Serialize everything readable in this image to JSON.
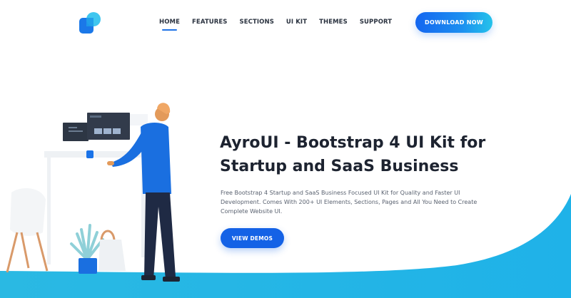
{
  "header": {
    "logo": "ayroui-logo",
    "nav": [
      {
        "label": "HOME",
        "active": true
      },
      {
        "label": "FEATURES",
        "active": false
      },
      {
        "label": "SECTIONS",
        "active": false
      },
      {
        "label": "UI KIT",
        "active": false
      },
      {
        "label": "THEMES",
        "active": false
      },
      {
        "label": "SUPPORT",
        "active": false
      }
    ],
    "cta_label": "DOWNLOAD NOW"
  },
  "hero": {
    "title_line1": "AyroUI - Bootstrap 4 UI Kit for",
    "title_line2": "Startup and SaaS Business",
    "desc_line1": "Free Bootstrap 4 Startup and SaaS Business Focused UI Kit for Quality and Faster UI",
    "desc_line2": "Development. Comes With 200+ UI Elements, Sections, Pages and All You Need to Create",
    "desc_line3": "Complete Website UI.",
    "button_label": "VIEW DEMOS"
  },
  "colors": {
    "accent": "#1462e6",
    "gradient_end": "#25c3ea",
    "wave": "#22b8e6",
    "text_dark": "#1d2330"
  }
}
